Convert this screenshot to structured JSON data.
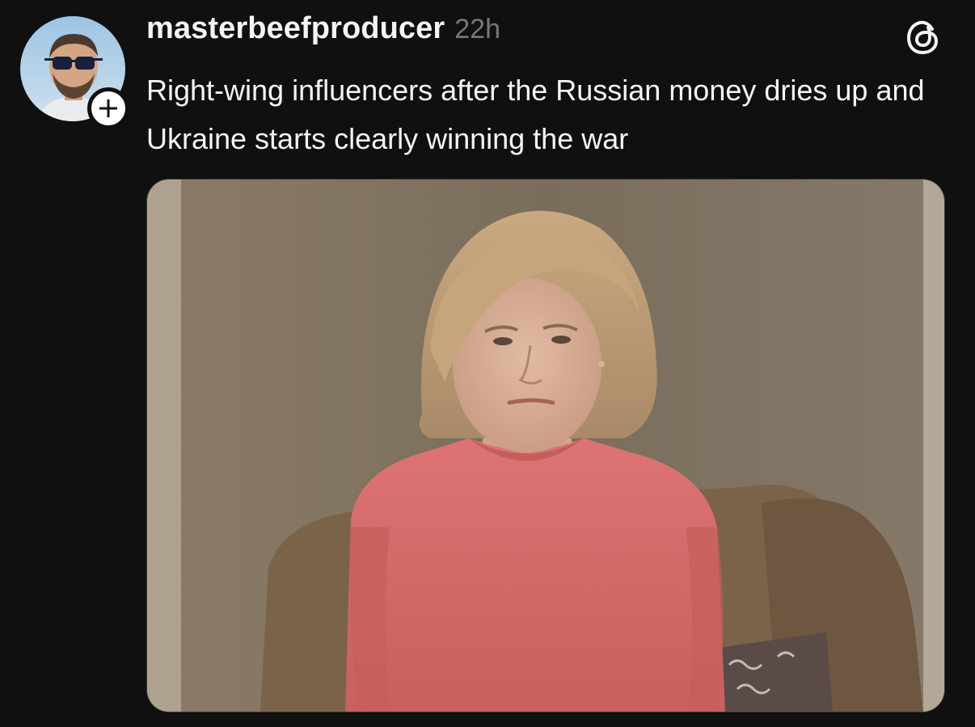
{
  "post": {
    "username": "masterbeefproducer",
    "timestamp": "22h",
    "text": "Right-wing influencers after the Russian money dries up and Ukraine starts clearly winning the war"
  },
  "icons": {
    "follow": "plus-icon",
    "app_logo": "threads-logo-icon"
  },
  "colors": {
    "background": "#101010",
    "text_primary": "#f3f5f7",
    "text_secondary": "#777777",
    "sweater": "#d96f70",
    "wall": "#7d705e",
    "couch": "#7b6349"
  }
}
